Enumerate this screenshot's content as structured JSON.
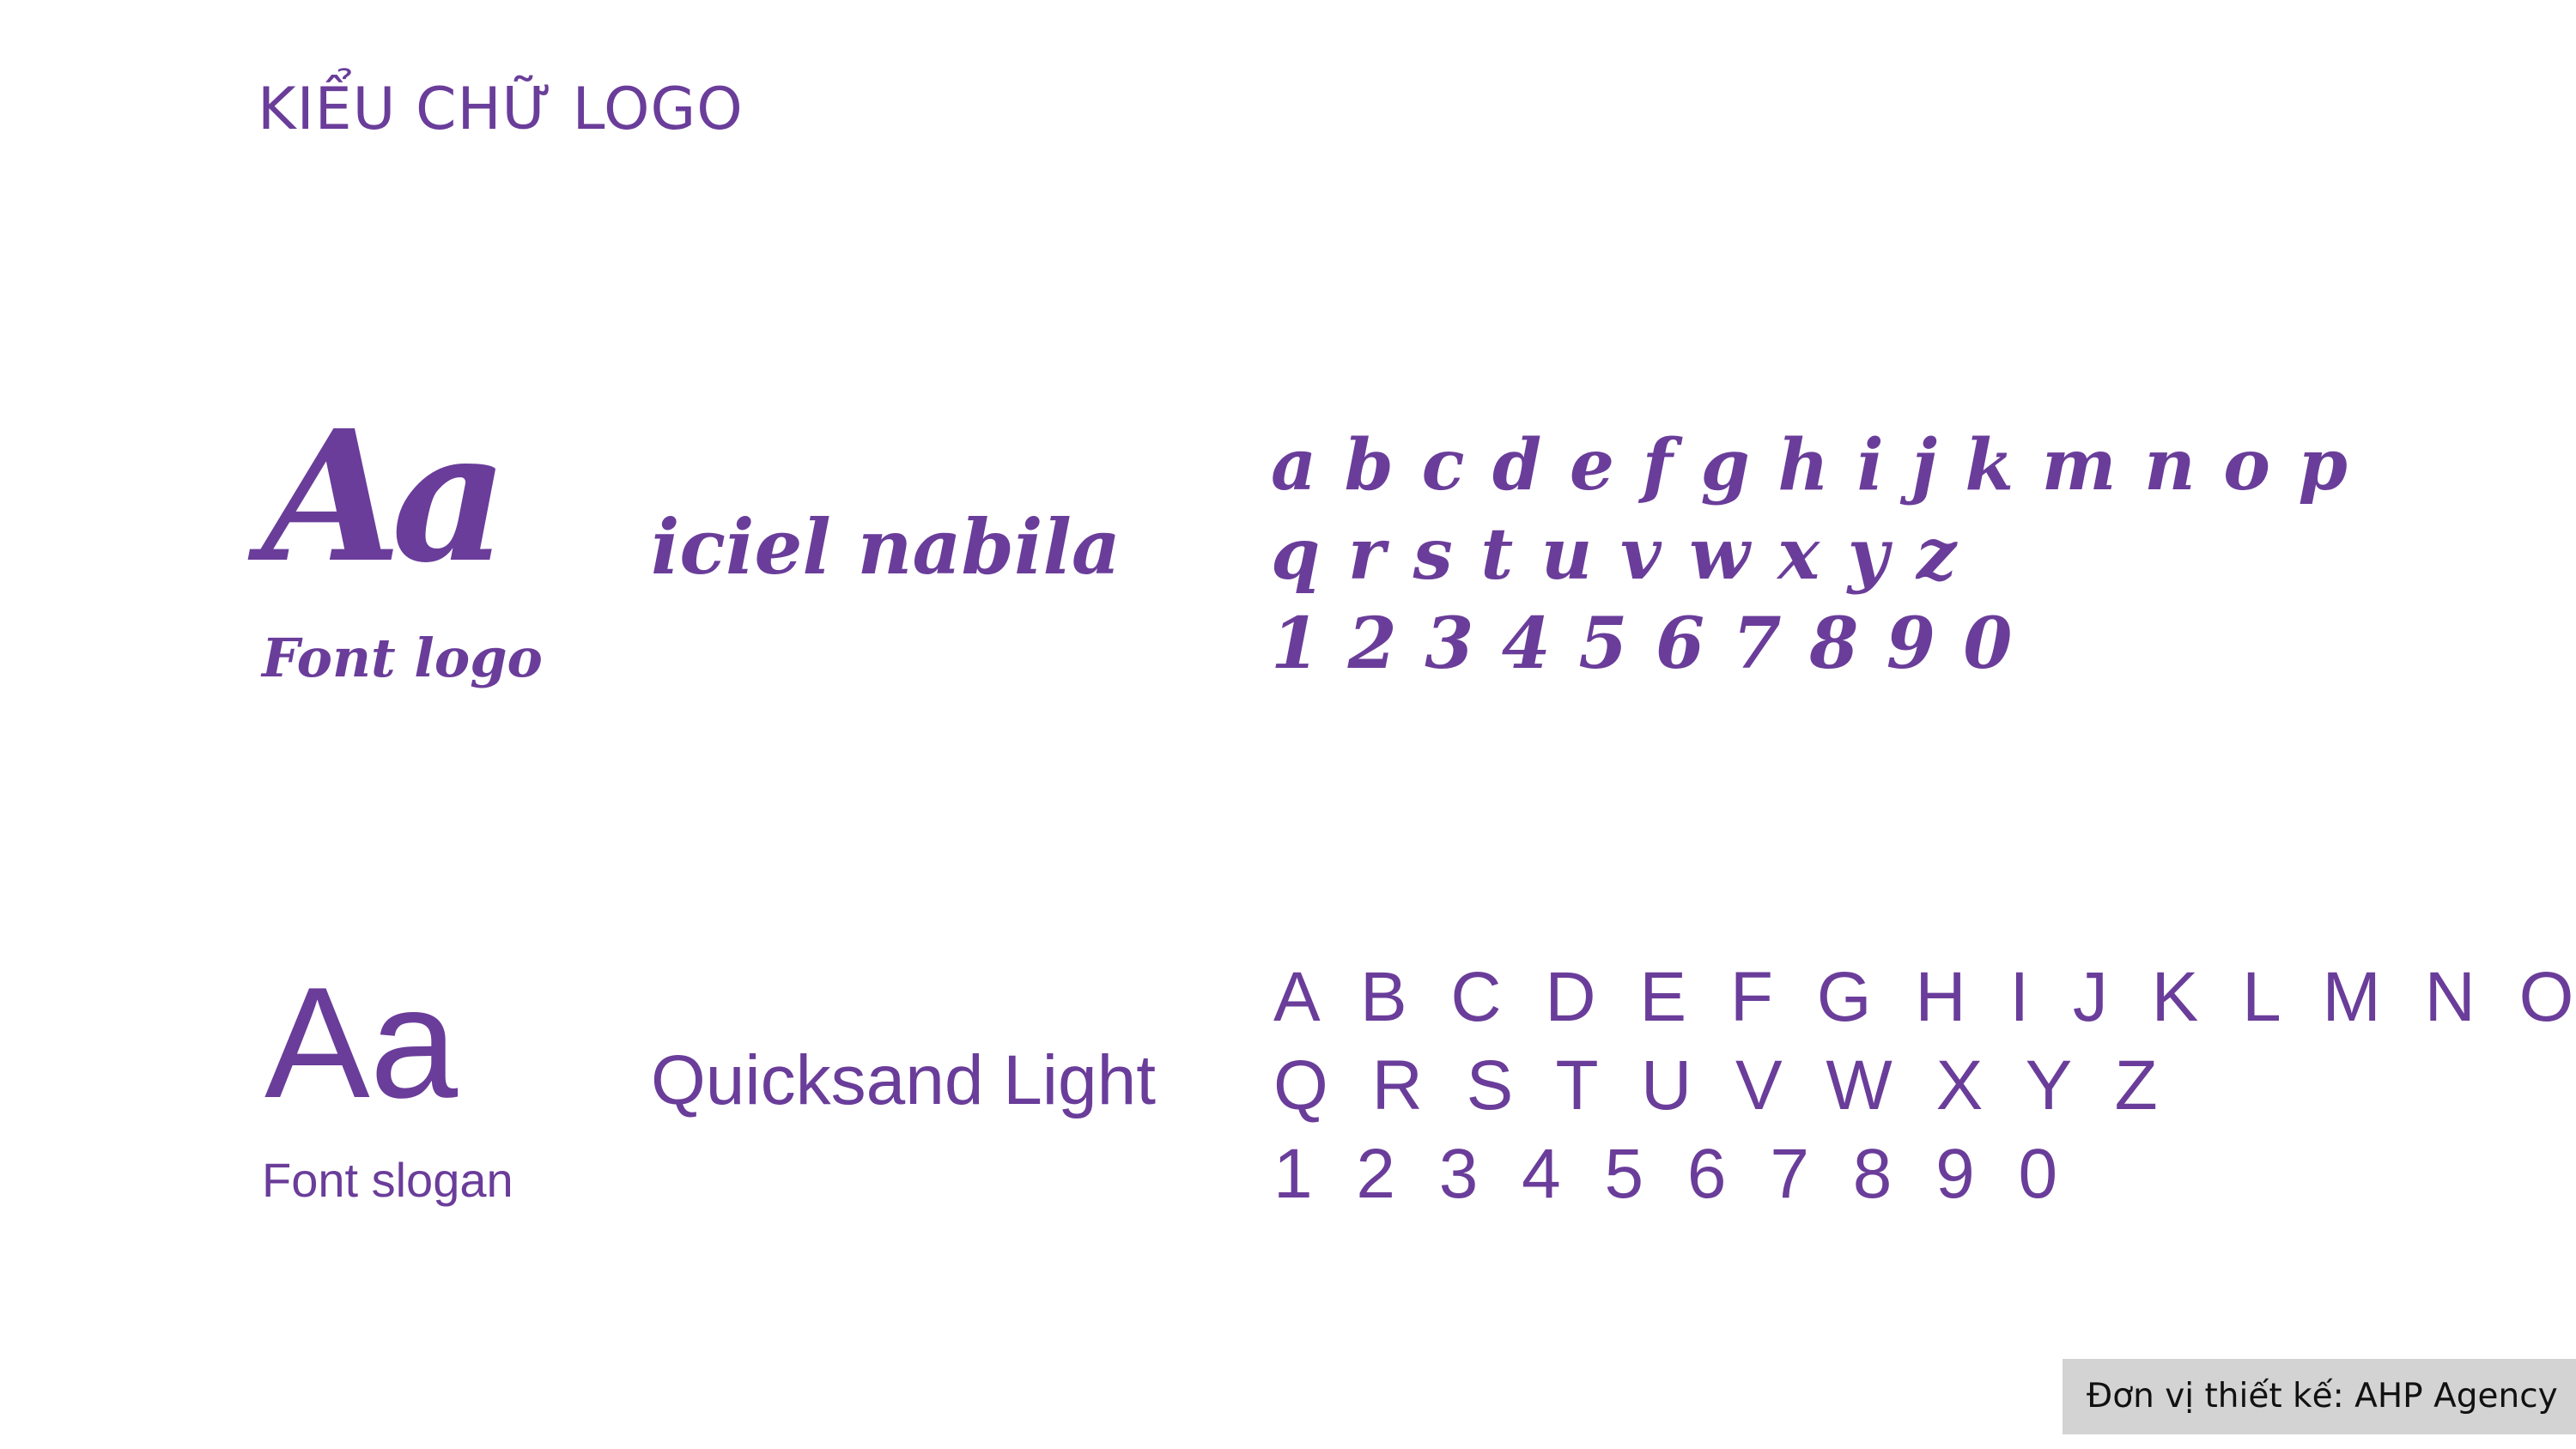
{
  "title": "KIỂU CHỮ LOGO",
  "logo_font": {
    "sample": "Aa",
    "label": "Font logo",
    "name": "iciel nabila",
    "lines": [
      "a b c d e f g h i j k m n o p",
      "q r s t u v w x y z",
      "1 2 3 4 5 6 7 8 9 0"
    ]
  },
  "slogan_font": {
    "sample": "Aa",
    "label": "Font slogan",
    "name": "Quicksand Light",
    "lines": [
      "A B C D E F G H I J K L M N O P",
      "Q R S T U V W X Y Z",
      "1 2 3 4 5 6 7 8 9 0"
    ]
  },
  "credit": "Đơn vị thiết kế: AHP Agency",
  "colors": {
    "accent": "#6a3d9a",
    "credit_bg": "#d3d3d3"
  }
}
